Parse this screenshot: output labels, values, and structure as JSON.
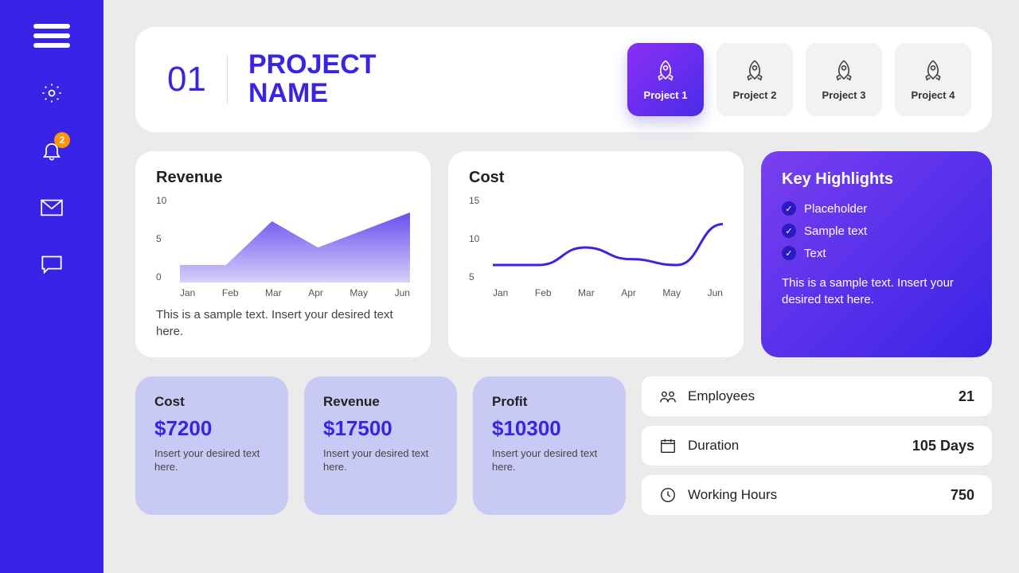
{
  "sidebar": {
    "notification_count": "2"
  },
  "header": {
    "number": "01",
    "title_line1": "PROJECT",
    "title_line2": "NAME"
  },
  "projects": [
    {
      "label": "Project 1",
      "active": true
    },
    {
      "label": "Project 2",
      "active": false
    },
    {
      "label": "Project 3",
      "active": false
    },
    {
      "label": "Project 4",
      "active": false
    }
  ],
  "revenue_card": {
    "title": "Revenue",
    "caption": "This is a sample text. Insert your desired text here."
  },
  "cost_card": {
    "title": "Cost"
  },
  "highlights": {
    "title": "Key Highlights",
    "items": [
      "Placeholder",
      "Sample text",
      "Text"
    ],
    "desc": "This is a sample text. Insert your desired text here."
  },
  "metrics": [
    {
      "label": "Cost",
      "value": "$7200",
      "desc": "Insert your desired text here."
    },
    {
      "label": "Revenue",
      "value": "$17500",
      "desc": "Insert your desired text here."
    },
    {
      "label": "Profit",
      "value": "$10300",
      "desc": "Insert your desired text here."
    }
  ],
  "stats": [
    {
      "label": "Employees",
      "value": "21",
      "icon": "users"
    },
    {
      "label": "Duration",
      "value": "105 Days",
      "icon": "calendar"
    },
    {
      "label": "Working Hours",
      "value": "750",
      "icon": "clock"
    }
  ],
  "chart_data": [
    {
      "type": "area",
      "title": "Revenue",
      "categories": [
        "Jan",
        "Feb",
        "Mar",
        "Apr",
        "May",
        "Jun"
      ],
      "values": [
        2,
        2,
        7,
        4,
        6,
        8
      ],
      "ylim": [
        0,
        10
      ],
      "yticks": [
        0,
        5,
        10
      ]
    },
    {
      "type": "line",
      "title": "Cost",
      "categories": [
        "Jan",
        "Feb",
        "Mar",
        "Apr",
        "May",
        "Jun"
      ],
      "values": [
        3,
        3,
        6,
        4,
        3,
        10
      ],
      "ylim": [
        0,
        15
      ],
      "yticks": [
        5,
        10,
        15
      ]
    }
  ]
}
